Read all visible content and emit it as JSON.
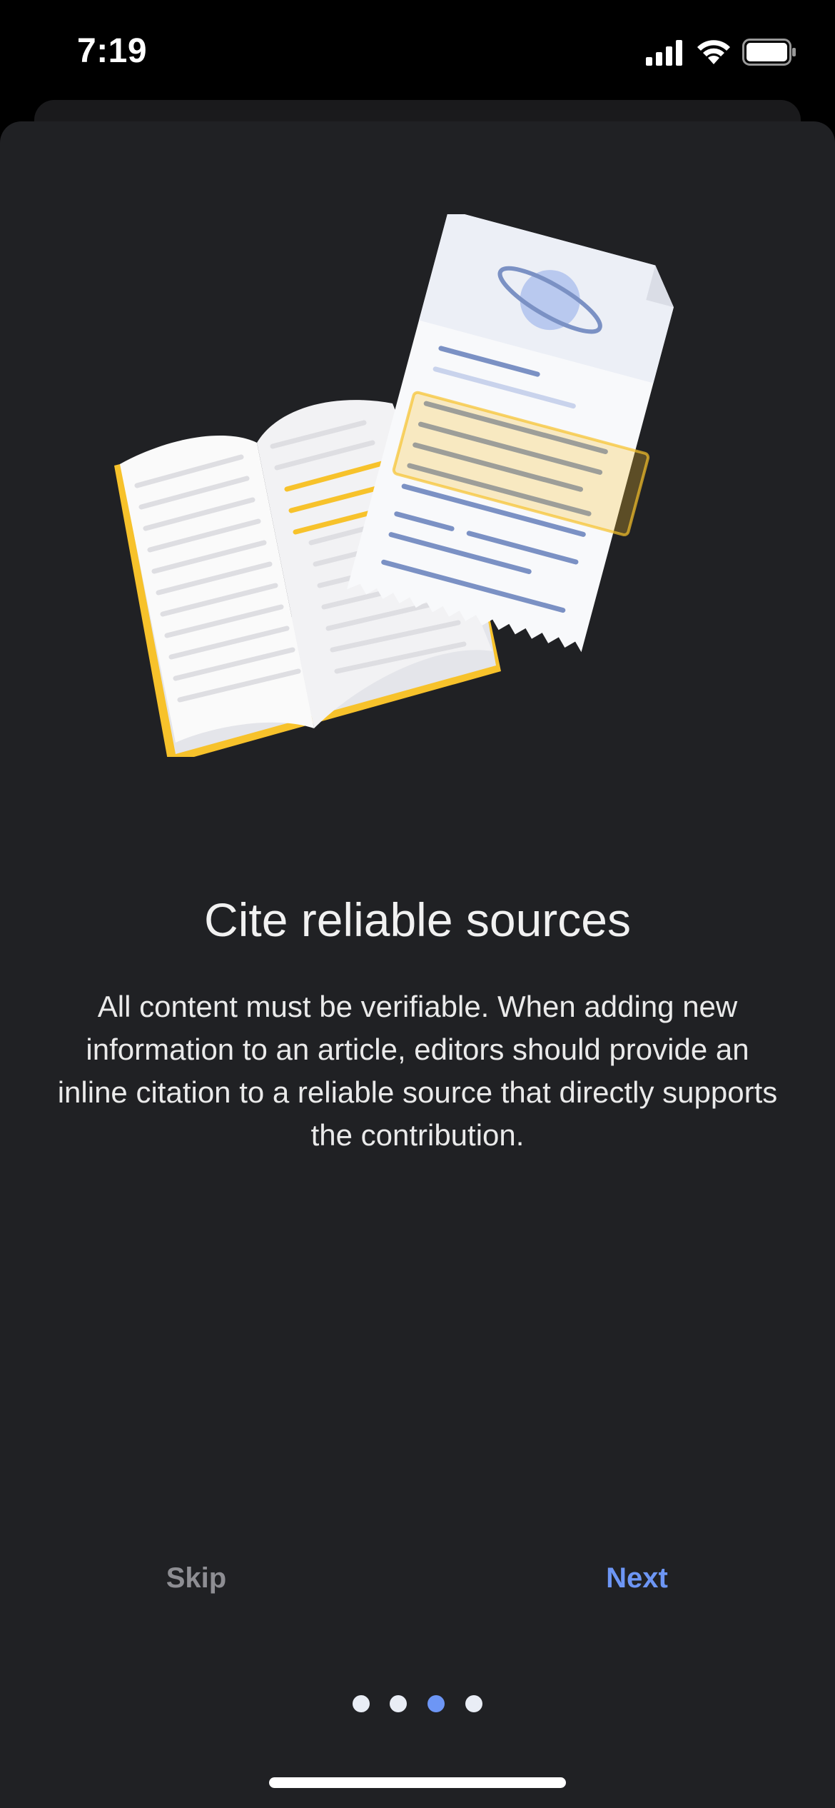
{
  "status_bar": {
    "time": "7:19",
    "icons": [
      "signal-icon",
      "wifi-icon",
      "battery-icon"
    ]
  },
  "onboarding": {
    "illustration": "book-and-citation-document-illustration",
    "title": "Cite reliable sources",
    "body": "All content must be verifiable. When adding new information to an article, editors should provide an inline citation to a reliable source that directly supports the contribution.",
    "skip_label": "Skip",
    "next_label": "Next",
    "page_count": 4,
    "current_page": 3
  },
  "colors": {
    "background": "#000000",
    "sheet": "#202124",
    "accent": "#6d96f5",
    "skip": "#8e8e93",
    "highlight": "#f7c22b"
  }
}
